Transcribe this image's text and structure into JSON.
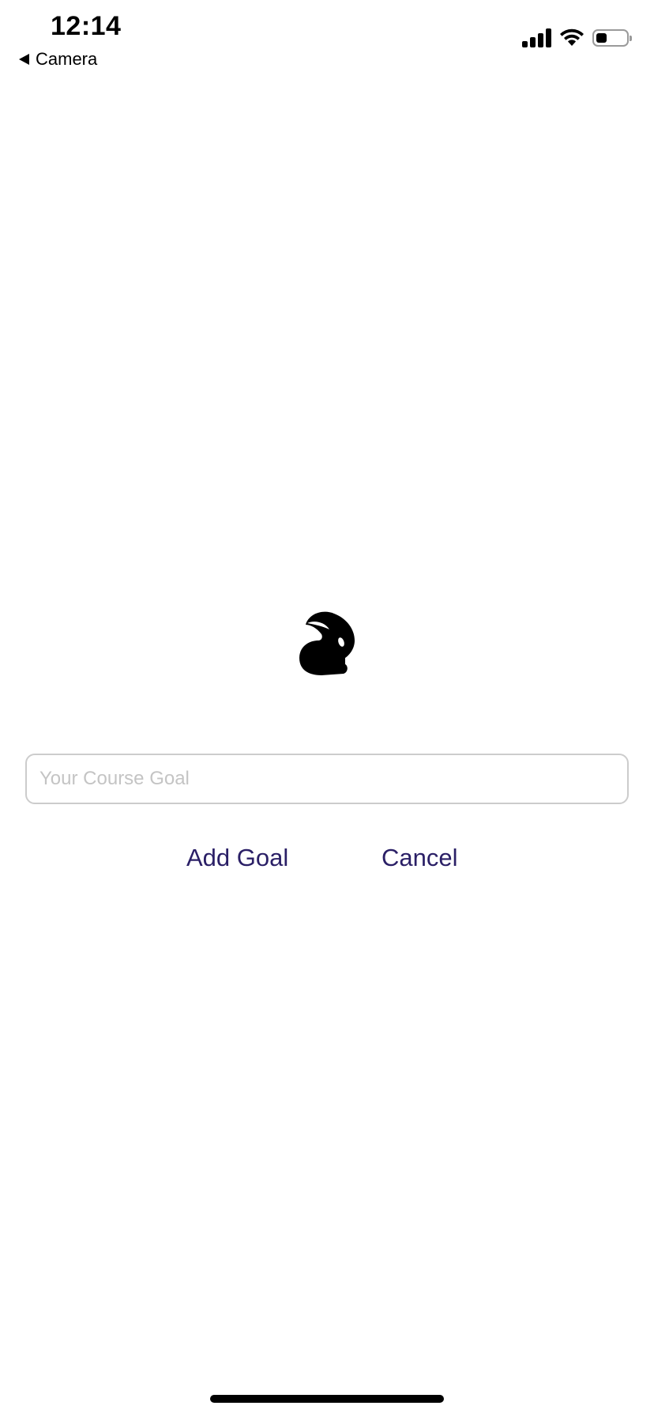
{
  "status_bar": {
    "time": "12:14",
    "back_label": "Camera",
    "icons": [
      "cellular-signal-icon",
      "wifi-icon",
      "battery-icon"
    ]
  },
  "app": {
    "logo_icon": "rabbit-icon",
    "goal_input": {
      "placeholder": "Your Course Goal",
      "value": ""
    },
    "add_label": "Add Goal",
    "cancel_label": "Cancel",
    "accent_color": "#2a1f66"
  }
}
